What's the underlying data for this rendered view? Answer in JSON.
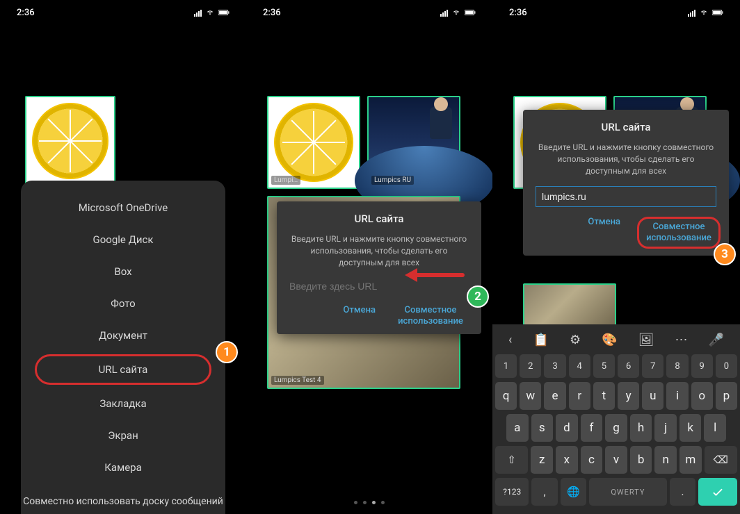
{
  "status": {
    "time": "2:36"
  },
  "screen1": {
    "menu": {
      "items": [
        "Microsoft OneDrive",
        "Google Диск",
        "Box",
        "Фото",
        "Документ",
        "URL сайта",
        "Закладка",
        "Экран",
        "Камера"
      ],
      "footer": "Совместно использовать доску сообщений"
    },
    "badge": "1"
  },
  "screen2": {
    "dialog": {
      "title": "URL сайта",
      "body": "Введите URL и нажмите кнопку совместного использования, чтобы сделать его доступным для всех",
      "placeholder": "Введите здесь URL",
      "cancel": "Отмена",
      "share": "Совместное использование"
    },
    "thumb_labels": {
      "space": "Lumpics RU",
      "room": "Lumpics Test 4"
    },
    "badge": "2"
  },
  "screen3": {
    "dialog": {
      "title": "URL сайта",
      "body": "Введите URL и нажмите кнопку совместного использования, чтобы сделать его доступным для всех",
      "value": "lumpics.ru",
      "cancel": "Отмена",
      "share": "Совместное использование"
    },
    "badge": "3",
    "keyboard": {
      "row_num": [
        "1",
        "2",
        "3",
        "4",
        "5",
        "6",
        "7",
        "8",
        "9",
        "0"
      ],
      "row_q": [
        "q",
        "w",
        "e",
        "r",
        "t",
        "y",
        "u",
        "i",
        "o",
        "p"
      ],
      "row_a": [
        "a",
        "s",
        "d",
        "f",
        "g",
        "h",
        "j",
        "k",
        "l"
      ],
      "row_z": [
        "z",
        "x",
        "c",
        "v",
        "b",
        "n",
        "m"
      ],
      "shift": "⇧",
      "backspace": "⌫",
      "sym": "?123",
      "comma": ",",
      "lang": "🌐",
      "space": "QWERTY",
      "dot": ".",
      "tool_icons": [
        "‹",
        "📋",
        "⚙",
        "🎨",
        "🖼",
        "⋯",
        "🎤"
      ]
    }
  }
}
